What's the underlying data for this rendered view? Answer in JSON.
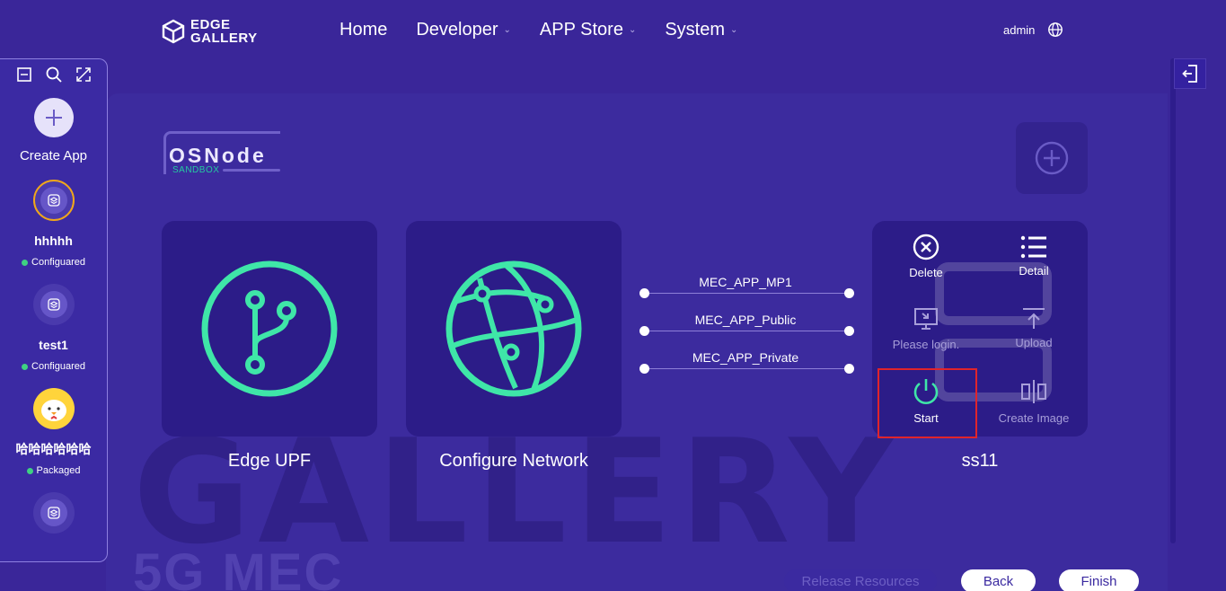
{
  "header": {
    "logo_line1": "EDGE",
    "logo_line2": "GALLERY",
    "nav": [
      {
        "label": "Home",
        "has_dropdown": false
      },
      {
        "label": "Developer",
        "has_dropdown": true
      },
      {
        "label": "APP Store",
        "has_dropdown": true
      },
      {
        "label": "System",
        "has_dropdown": true
      }
    ],
    "user": "admin",
    "language_icon": "globe-icon"
  },
  "sidebar": {
    "tools": [
      "collapse-icon",
      "search-icon",
      "expand-icon"
    ],
    "create_label": "Create App",
    "apps": [
      {
        "name": "hhhhh",
        "status": "Configuared",
        "selected": true
      },
      {
        "name": "test1",
        "status": "Configuared",
        "selected": false
      },
      {
        "name": "哈哈哈哈哈哈",
        "status": "Packaged",
        "selected": false
      }
    ],
    "status_color": "#3fd182"
  },
  "main": {
    "watermark_letters": "GALLERY",
    "watermark_5g": "5G MEC",
    "title": "OSNode",
    "subtitle": "SANDBOX",
    "cards": [
      {
        "label": "Edge UPF",
        "icon": "git-branch-icon"
      },
      {
        "label": "Configure Network",
        "icon": "network-globe-icon"
      }
    ],
    "networks": [
      "MEC_APP_MP1",
      "MEC_APP_Public",
      "MEC_APP_Private"
    ],
    "app_name": "ss11",
    "actions": {
      "delete": "Delete",
      "detail": "Detail",
      "login": "Please login.",
      "upload": "Upload",
      "start": "Start",
      "create_image": "Create Image"
    },
    "accent": "#3fe6a8",
    "highlight_color": "#e0242b"
  },
  "footer": {
    "release": "Release Resources",
    "back": "Back",
    "finish": "Finish"
  }
}
